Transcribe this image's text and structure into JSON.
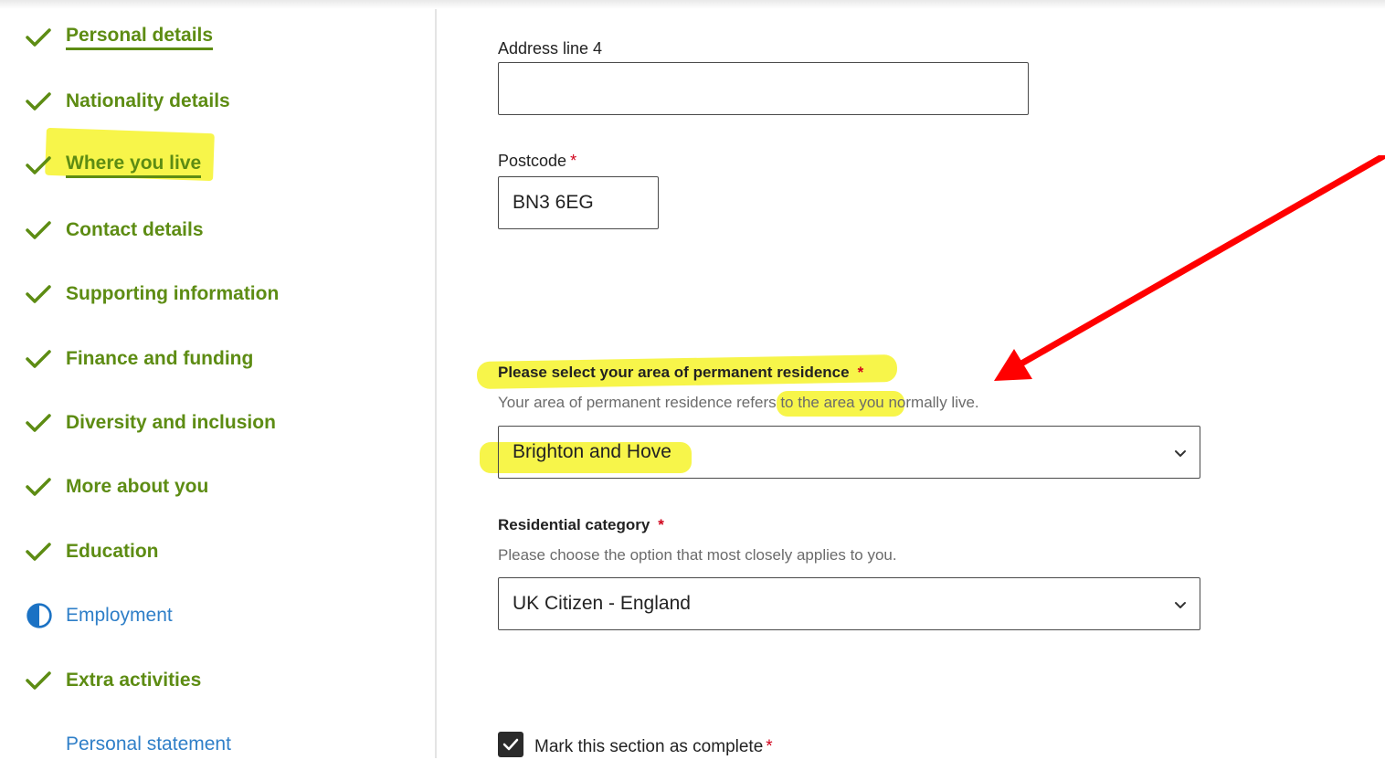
{
  "sidebar": {
    "items": [
      {
        "label": "Personal details",
        "status": "done"
      },
      {
        "label": "Nationality details",
        "status": "done"
      },
      {
        "label": "Where you live",
        "status": "done-active"
      },
      {
        "label": "Contact details",
        "status": "done"
      },
      {
        "label": "Supporting information",
        "status": "done"
      },
      {
        "label": "Finance and funding",
        "status": "done"
      },
      {
        "label": "Diversity and inclusion",
        "status": "done"
      },
      {
        "label": "More about you",
        "status": "done"
      },
      {
        "label": "Education",
        "status": "done"
      },
      {
        "label": "Employment",
        "status": "in-progress"
      },
      {
        "label": "Extra activities",
        "status": "done"
      },
      {
        "label": "Personal statement",
        "status": "not-started"
      }
    ]
  },
  "form": {
    "address_line_4": {
      "label": "Address line 4",
      "value": ""
    },
    "postcode": {
      "label": "Postcode",
      "required_mark": "*",
      "value": "BN3 6EG"
    },
    "area": {
      "label": "Please select your area of permanent residence",
      "required_mark": "*",
      "hint": "Your area of permanent residence refers to the area you normally live.",
      "selected": "Brighton and Hove"
    },
    "residential_category": {
      "label": "Residential category",
      "required_mark": "*",
      "hint": "Please choose the option that most closely applies to you.",
      "selected": "UK Citizen - England"
    },
    "complete": {
      "label": "Mark this section as complete",
      "required_mark": "*",
      "checked": true
    }
  },
  "icons": {
    "done": "checkmark-icon",
    "in_progress": "half-circle-icon",
    "dropdown": "chevron-down-icon",
    "annotation": "red-arrow"
  },
  "colors": {
    "done_green": "#5d8c13",
    "link_blue": "#2f7fc8",
    "highlight": "#f6f32a",
    "annotation_red": "#ff0000",
    "required_red": "#d0021b"
  }
}
